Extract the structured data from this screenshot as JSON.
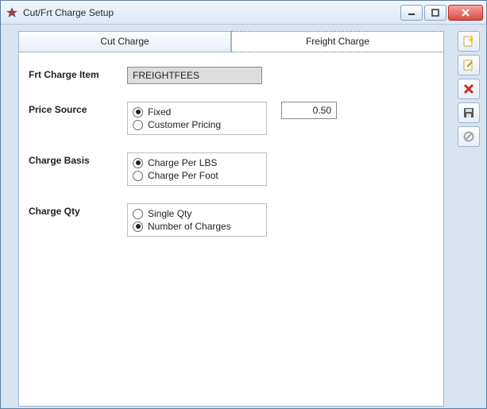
{
  "window": {
    "title": "Cut/Frt Charge Setup"
  },
  "tabs": {
    "cut": "Cut Charge",
    "freight": "Freight Charge",
    "active": "freight"
  },
  "form": {
    "frt_item_label": "Frt Charge Item",
    "frt_item_value": "FREIGHTFEES",
    "price_source_label": "Price Source",
    "price_source": {
      "fixed": "Fixed",
      "customer": "Customer Pricing",
      "selected": "fixed",
      "price_value": "0.50"
    },
    "charge_basis_label": "Charge Basis",
    "charge_basis": {
      "per_lbs": "Charge Per LBS",
      "per_foot": "Charge Per Foot",
      "selected": "per_lbs"
    },
    "charge_qty_label": "Charge Qty",
    "charge_qty": {
      "single": "Single Qty",
      "number": "Number of Charges",
      "selected": "number"
    }
  },
  "sidebar": {
    "new": "new",
    "edit": "edit",
    "delete": "delete",
    "save": "save",
    "cancel": "cancel"
  }
}
